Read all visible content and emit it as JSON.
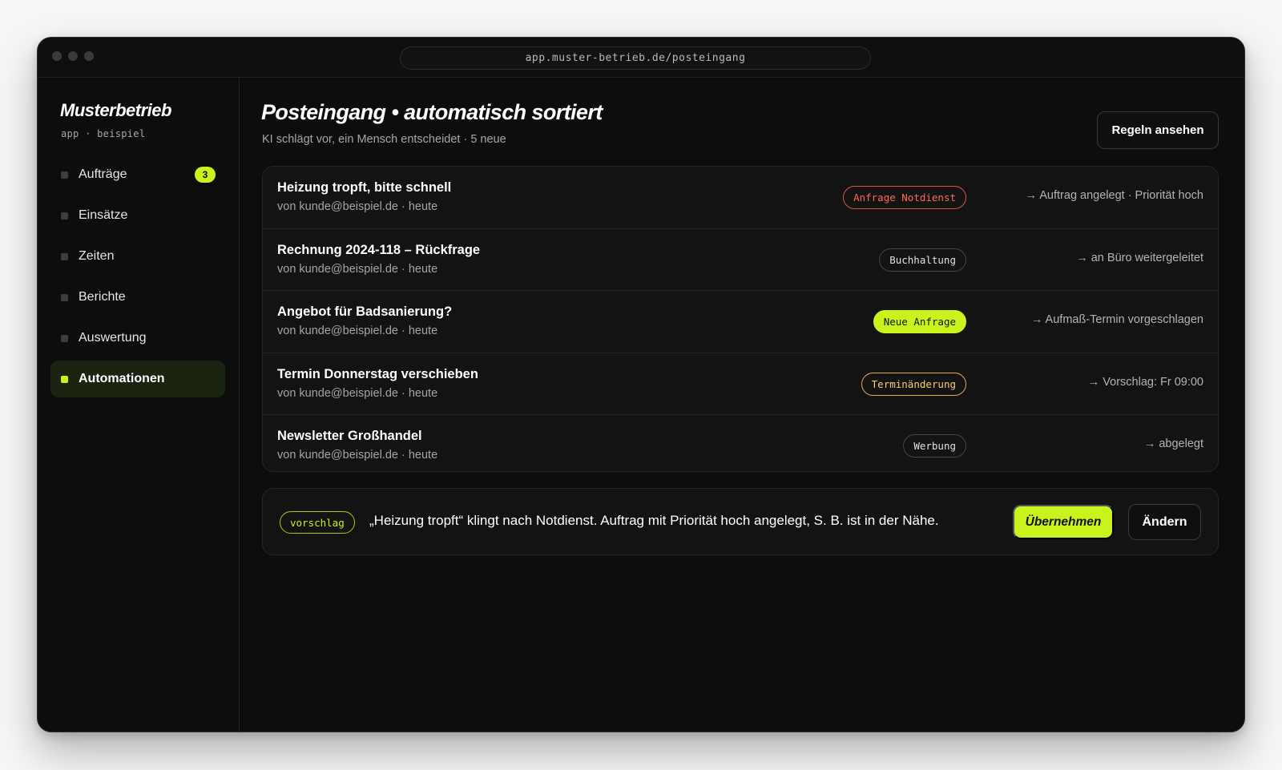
{
  "browser": {
    "url": "app.muster-betrieb.de/posteingang"
  },
  "sidebar": {
    "brand": "Musterbetrieb",
    "brand_sub": "app · beispiel",
    "items": [
      {
        "label": "Aufträge",
        "count": "3",
        "active": false
      },
      {
        "label": "Einsätze",
        "active": false
      },
      {
        "label": "Zeiten",
        "active": false
      },
      {
        "label": "Berichte",
        "active": false
      },
      {
        "label": "Auswertung",
        "active": false
      },
      {
        "label": "Automationen",
        "active": true
      }
    ]
  },
  "header": {
    "title": "Posteingang • automatisch sortiert",
    "subtitle": "KI schlägt vor, ein Mensch entscheidet · 5 neue",
    "rules_button": "Regeln ansehen"
  },
  "inbox": {
    "rows": [
      {
        "subject": "Heizung tropft, bitte schnell",
        "meta": "von kunde@beispiel.de · heute",
        "tag": "Anfrage Notdienst",
        "tag_style": "red",
        "action": "→ Auftrag angelegt · Priorität hoch"
      },
      {
        "subject": "Rechnung 2024-118 – Rückfrage",
        "meta": "von kunde@beispiel.de · heute",
        "tag": "Buchhaltung",
        "tag_style": "neutral",
        "action": "→ an Büro weitergeleitet"
      },
      {
        "subject": "Angebot für Badsanierung?",
        "meta": "von kunde@beispiel.de · heute",
        "tag": "Neue Anfrage",
        "tag_style": "lime",
        "action": "→ Aufmaß-Termin vorgeschlagen"
      },
      {
        "subject": "Termin Donnerstag verschieben",
        "meta": "von kunde@beispiel.de · heute",
        "tag": "Terminänderung",
        "tag_style": "amber",
        "action": "→ Vorschlag: Fr 09:00"
      },
      {
        "subject": "Newsletter Großhandel",
        "meta": "von kunde@beispiel.de · heute",
        "tag": "Werbung",
        "tag_style": "neutral",
        "action": "→ abgelegt"
      }
    ]
  },
  "suggestion": {
    "tag": "vorschlag",
    "text": "„Heizung tropft“ klingt nach Notdienst. Auftrag mit Priorität hoch angelegt, S. B. ist in der Nähe.",
    "accept_label": "Übernehmen",
    "change_label": "Ändern"
  },
  "colors": {
    "accent": "#c9f31d",
    "background": "#0d0d0d",
    "danger": "#ff6a52",
    "warning": "#ffcb70"
  }
}
